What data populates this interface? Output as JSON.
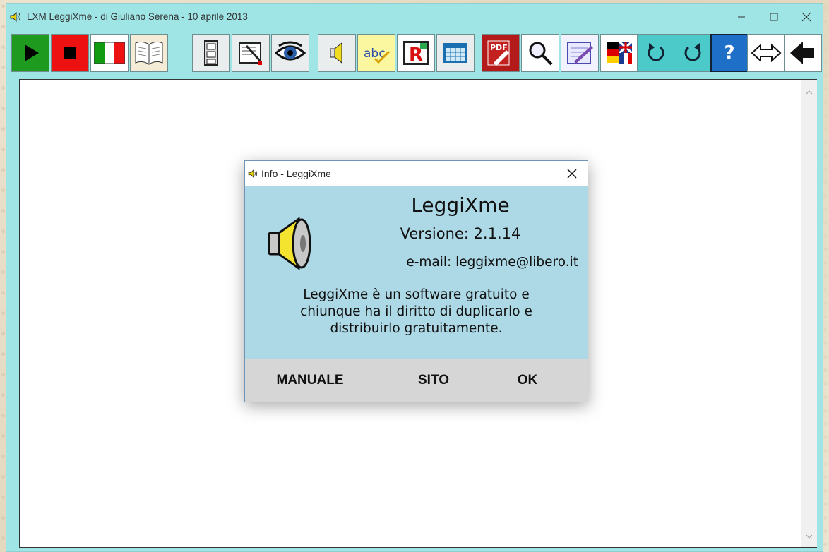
{
  "window": {
    "title": "LXM  LeggiXme - di Giuliano Serena - 10 aprile 2013",
    "controls": [
      "minimize",
      "maximize",
      "close"
    ]
  },
  "toolbar": {
    "buttons": [
      {
        "name": "play",
        "icon": "play-icon",
        "color": "#008000"
      },
      {
        "name": "stop",
        "icon": "stop-icon",
        "color": "#ff0000"
      },
      {
        "name": "italian-language",
        "icon": "italy-flag-icon"
      },
      {
        "name": "open-book",
        "icon": "book-icon"
      },
      {
        "name": "archive",
        "icon": "file-cabinet-icon"
      },
      {
        "name": "edit-text",
        "icon": "document-pen-icon"
      },
      {
        "name": "view",
        "icon": "eye-icon"
      },
      {
        "name": "speaker",
        "icon": "speaker-icon"
      },
      {
        "name": "spellcheck",
        "icon": "abc-check-icon"
      },
      {
        "name": "reading",
        "icon": "letter-r-icon"
      },
      {
        "name": "calendar",
        "icon": "calendar-icon"
      },
      {
        "name": "pdf",
        "icon": "pdf-icon",
        "label": "PDF"
      },
      {
        "name": "search",
        "icon": "magnifier-icon"
      },
      {
        "name": "notepad",
        "icon": "notepad-icon"
      },
      {
        "name": "translate",
        "icon": "flags-icon"
      },
      {
        "name": "undo",
        "icon": "rotate-left-icon"
      },
      {
        "name": "redo",
        "icon": "rotate-right-icon"
      },
      {
        "name": "help",
        "icon": "help-icon",
        "label": "?"
      },
      {
        "name": "resize",
        "icon": "double-arrow-icon"
      },
      {
        "name": "back",
        "icon": "back-arrow-icon"
      }
    ]
  },
  "dialog": {
    "title": "Info - LeggiXme",
    "app_name": "LeggiXme",
    "version": "Versione: 2.1.14",
    "email": "e-mail: leggixme@libero.it",
    "description_lines": [
      "LeggiXme è un software gratuito e",
      "chiunque ha il diritto di duplicarlo e",
      "distribuirlo gratuitamente."
    ],
    "buttons": {
      "manual": "MANUALE",
      "site": "SITO",
      "ok": "OK"
    }
  },
  "colors": {
    "window_bg": "#9fe5e6",
    "dialog_body": "#add8e6",
    "dialog_footer": "#d6d6d6"
  }
}
